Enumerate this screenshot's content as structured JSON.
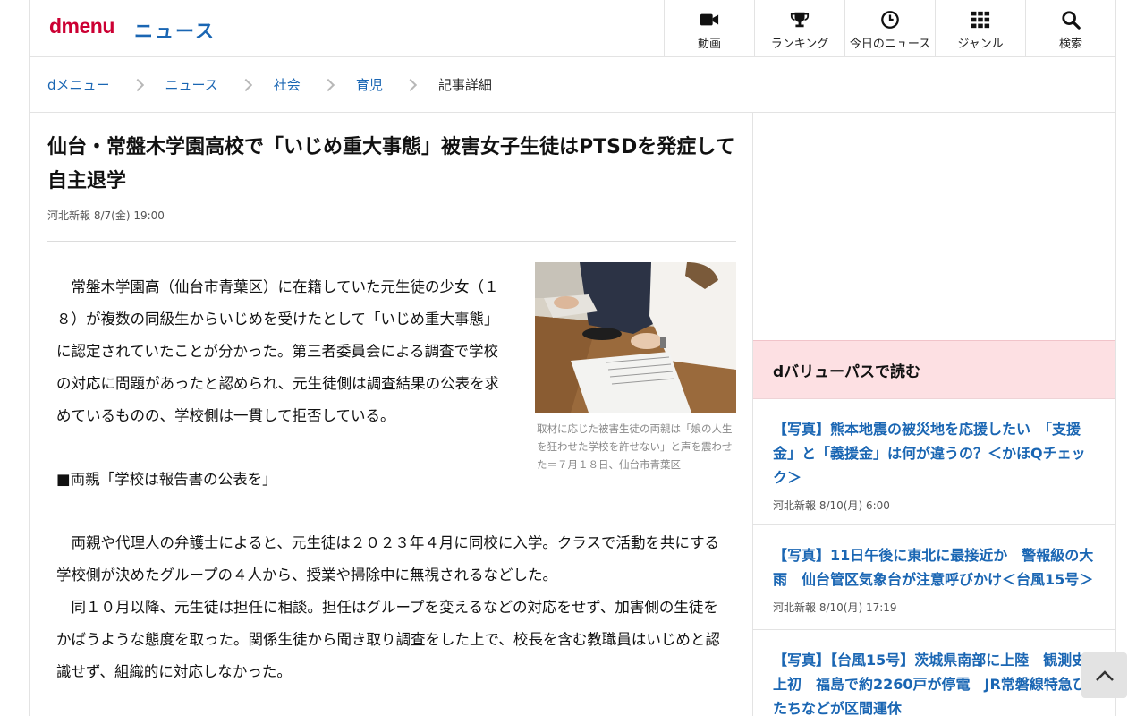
{
  "header": {
    "logo": "dmenu",
    "section_title": "ニュース",
    "nav": [
      {
        "label": "動画",
        "icon": "video-camera-icon"
      },
      {
        "label": "ランキング",
        "icon": "trophy-icon"
      },
      {
        "label": "今日のニュース",
        "icon": "clock-icon"
      },
      {
        "label": "ジャンル",
        "icon": "grid-icon"
      },
      {
        "label": "検索",
        "icon": "search-icon"
      }
    ]
  },
  "breadcrumb": [
    "dメニュー",
    "ニュース",
    "社会",
    "育児",
    "記事詳細"
  ],
  "article": {
    "title": "仙台・常盤木学園高校で「いじめ重大事態」被害女子生徒はPTSDを発症して自主退学",
    "source": "河北新報",
    "datetime": "8/7(金) 19:00",
    "photo_caption": "取材に応じた被害生徒の両親は「娘の人生を狂わせた学校を許せない」と声を震わせた＝７月１８日、仙台市青葉区",
    "lead": "常盤木学園高（仙台市青葉区）に在籍していた元生徒の少女（１８）が複数の同級生からいじめを受けたとして「いじめ重大事態」に認定されていたことが分かった。第三者委員会による調査で学校の対応に問題があったと認められ、元生徒側は調査結果の公表を求めているものの、学校側は一貫して拒否している。",
    "subhead": "■両親「学校は報告書の公表を」",
    "body1": "両親や代理人の弁護士によると、元生徒は２０２３年４月に同校に入学。クラスで活動を共にする学校側が決めたグループの４人から、授業や掃除中に無視されるなどした。",
    "body2": "同１０月以降、元生徒は担任に相談。担任はグループを変えるなどの対応をせず、加害側の生徒をかばうような態度を取った。関係生徒から聞き取り調査をした上で、校長を含む教職員はいじめと認識せず、組織的に対応しなかった。"
  },
  "sidebar": {
    "heading": "dバリューパスで読む",
    "items": [
      {
        "title": "【写真】熊本地震の被災地を応援したい　「支援金」と「義援金」は何が違うの？＜かほQチェック＞",
        "source": "河北新報",
        "datetime": "8/10(月) 6:00"
      },
      {
        "title": "【写真】11日午後に東北に最接近か　警報級の大雨　仙台管区気象台が注意呼びかけ＜台風15号＞",
        "source": "河北新報",
        "datetime": "8/10(月) 17:19"
      },
      {
        "title": "【写真】【台風15号】茨城県南部に上陸　観測史上初　福島で約2260戸が停電　JR常磐線特急ひたちなどが区間運休",
        "source": "",
        "datetime": ""
      }
    ]
  },
  "colors": {
    "brand": "#cc0033",
    "link": "#1a66b3",
    "sidebar_head_bg": "#fde0e3"
  }
}
